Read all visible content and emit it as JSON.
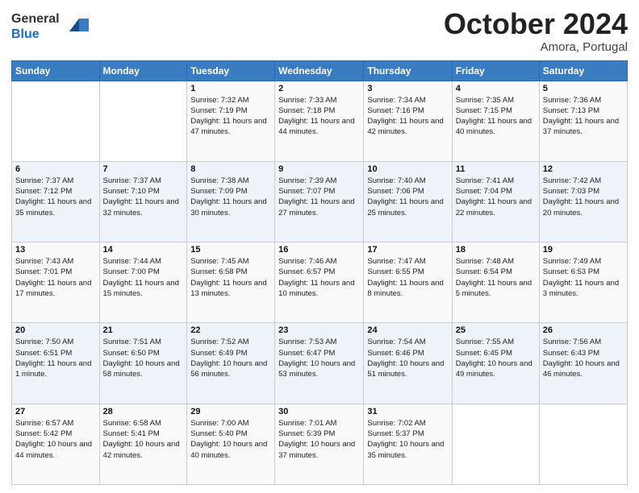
{
  "header": {
    "logo_general": "General",
    "logo_blue": "Blue",
    "month_title": "October 2024",
    "location": "Amora, Portugal"
  },
  "weekdays": [
    "Sunday",
    "Monday",
    "Tuesday",
    "Wednesday",
    "Thursday",
    "Friday",
    "Saturday"
  ],
  "weeks": [
    [
      {
        "day": "",
        "sunrise": "",
        "sunset": "",
        "daylight": ""
      },
      {
        "day": "",
        "sunrise": "",
        "sunset": "",
        "daylight": ""
      },
      {
        "day": "1",
        "sunrise": "Sunrise: 7:32 AM",
        "sunset": "Sunset: 7:19 PM",
        "daylight": "Daylight: 11 hours and 47 minutes."
      },
      {
        "day": "2",
        "sunrise": "Sunrise: 7:33 AM",
        "sunset": "Sunset: 7:18 PM",
        "daylight": "Daylight: 11 hours and 44 minutes."
      },
      {
        "day": "3",
        "sunrise": "Sunrise: 7:34 AM",
        "sunset": "Sunset: 7:16 PM",
        "daylight": "Daylight: 11 hours and 42 minutes."
      },
      {
        "day": "4",
        "sunrise": "Sunrise: 7:35 AM",
        "sunset": "Sunset: 7:15 PM",
        "daylight": "Daylight: 11 hours and 40 minutes."
      },
      {
        "day": "5",
        "sunrise": "Sunrise: 7:36 AM",
        "sunset": "Sunset: 7:13 PM",
        "daylight": "Daylight: 11 hours and 37 minutes."
      }
    ],
    [
      {
        "day": "6",
        "sunrise": "Sunrise: 7:37 AM",
        "sunset": "Sunset: 7:12 PM",
        "daylight": "Daylight: 11 hours and 35 minutes."
      },
      {
        "day": "7",
        "sunrise": "Sunrise: 7:37 AM",
        "sunset": "Sunset: 7:10 PM",
        "daylight": "Daylight: 11 hours and 32 minutes."
      },
      {
        "day": "8",
        "sunrise": "Sunrise: 7:38 AM",
        "sunset": "Sunset: 7:09 PM",
        "daylight": "Daylight: 11 hours and 30 minutes."
      },
      {
        "day": "9",
        "sunrise": "Sunrise: 7:39 AM",
        "sunset": "Sunset: 7:07 PM",
        "daylight": "Daylight: 11 hours and 27 minutes."
      },
      {
        "day": "10",
        "sunrise": "Sunrise: 7:40 AM",
        "sunset": "Sunset: 7:06 PM",
        "daylight": "Daylight: 11 hours and 25 minutes."
      },
      {
        "day": "11",
        "sunrise": "Sunrise: 7:41 AM",
        "sunset": "Sunset: 7:04 PM",
        "daylight": "Daylight: 11 hours and 22 minutes."
      },
      {
        "day": "12",
        "sunrise": "Sunrise: 7:42 AM",
        "sunset": "Sunset: 7:03 PM",
        "daylight": "Daylight: 11 hours and 20 minutes."
      }
    ],
    [
      {
        "day": "13",
        "sunrise": "Sunrise: 7:43 AM",
        "sunset": "Sunset: 7:01 PM",
        "daylight": "Daylight: 11 hours and 17 minutes."
      },
      {
        "day": "14",
        "sunrise": "Sunrise: 7:44 AM",
        "sunset": "Sunset: 7:00 PM",
        "daylight": "Daylight: 11 hours and 15 minutes."
      },
      {
        "day": "15",
        "sunrise": "Sunrise: 7:45 AM",
        "sunset": "Sunset: 6:58 PM",
        "daylight": "Daylight: 11 hours and 13 minutes."
      },
      {
        "day": "16",
        "sunrise": "Sunrise: 7:46 AM",
        "sunset": "Sunset: 6:57 PM",
        "daylight": "Daylight: 11 hours and 10 minutes."
      },
      {
        "day": "17",
        "sunrise": "Sunrise: 7:47 AM",
        "sunset": "Sunset: 6:55 PM",
        "daylight": "Daylight: 11 hours and 8 minutes."
      },
      {
        "day": "18",
        "sunrise": "Sunrise: 7:48 AM",
        "sunset": "Sunset: 6:54 PM",
        "daylight": "Daylight: 11 hours and 5 minutes."
      },
      {
        "day": "19",
        "sunrise": "Sunrise: 7:49 AM",
        "sunset": "Sunset: 6:53 PM",
        "daylight": "Daylight: 11 hours and 3 minutes."
      }
    ],
    [
      {
        "day": "20",
        "sunrise": "Sunrise: 7:50 AM",
        "sunset": "Sunset: 6:51 PM",
        "daylight": "Daylight: 11 hours and 1 minute."
      },
      {
        "day": "21",
        "sunrise": "Sunrise: 7:51 AM",
        "sunset": "Sunset: 6:50 PM",
        "daylight": "Daylight: 10 hours and 58 minutes."
      },
      {
        "day": "22",
        "sunrise": "Sunrise: 7:52 AM",
        "sunset": "Sunset: 6:49 PM",
        "daylight": "Daylight: 10 hours and 56 minutes."
      },
      {
        "day": "23",
        "sunrise": "Sunrise: 7:53 AM",
        "sunset": "Sunset: 6:47 PM",
        "daylight": "Daylight: 10 hours and 53 minutes."
      },
      {
        "day": "24",
        "sunrise": "Sunrise: 7:54 AM",
        "sunset": "Sunset: 6:46 PM",
        "daylight": "Daylight: 10 hours and 51 minutes."
      },
      {
        "day": "25",
        "sunrise": "Sunrise: 7:55 AM",
        "sunset": "Sunset: 6:45 PM",
        "daylight": "Daylight: 10 hours and 49 minutes."
      },
      {
        "day": "26",
        "sunrise": "Sunrise: 7:56 AM",
        "sunset": "Sunset: 6:43 PM",
        "daylight": "Daylight: 10 hours and 46 minutes."
      }
    ],
    [
      {
        "day": "27",
        "sunrise": "Sunrise: 6:57 AM",
        "sunset": "Sunset: 5:42 PM",
        "daylight": "Daylight: 10 hours and 44 minutes."
      },
      {
        "day": "28",
        "sunrise": "Sunrise: 6:58 AM",
        "sunset": "Sunset: 5:41 PM",
        "daylight": "Daylight: 10 hours and 42 minutes."
      },
      {
        "day": "29",
        "sunrise": "Sunrise: 7:00 AM",
        "sunset": "Sunset: 5:40 PM",
        "daylight": "Daylight: 10 hours and 40 minutes."
      },
      {
        "day": "30",
        "sunrise": "Sunrise: 7:01 AM",
        "sunset": "Sunset: 5:39 PM",
        "daylight": "Daylight: 10 hours and 37 minutes."
      },
      {
        "day": "31",
        "sunrise": "Sunrise: 7:02 AM",
        "sunset": "Sunset: 5:37 PM",
        "daylight": "Daylight: 10 hours and 35 minutes."
      },
      {
        "day": "",
        "sunrise": "",
        "sunset": "",
        "daylight": ""
      },
      {
        "day": "",
        "sunrise": "",
        "sunset": "",
        "daylight": ""
      }
    ]
  ]
}
